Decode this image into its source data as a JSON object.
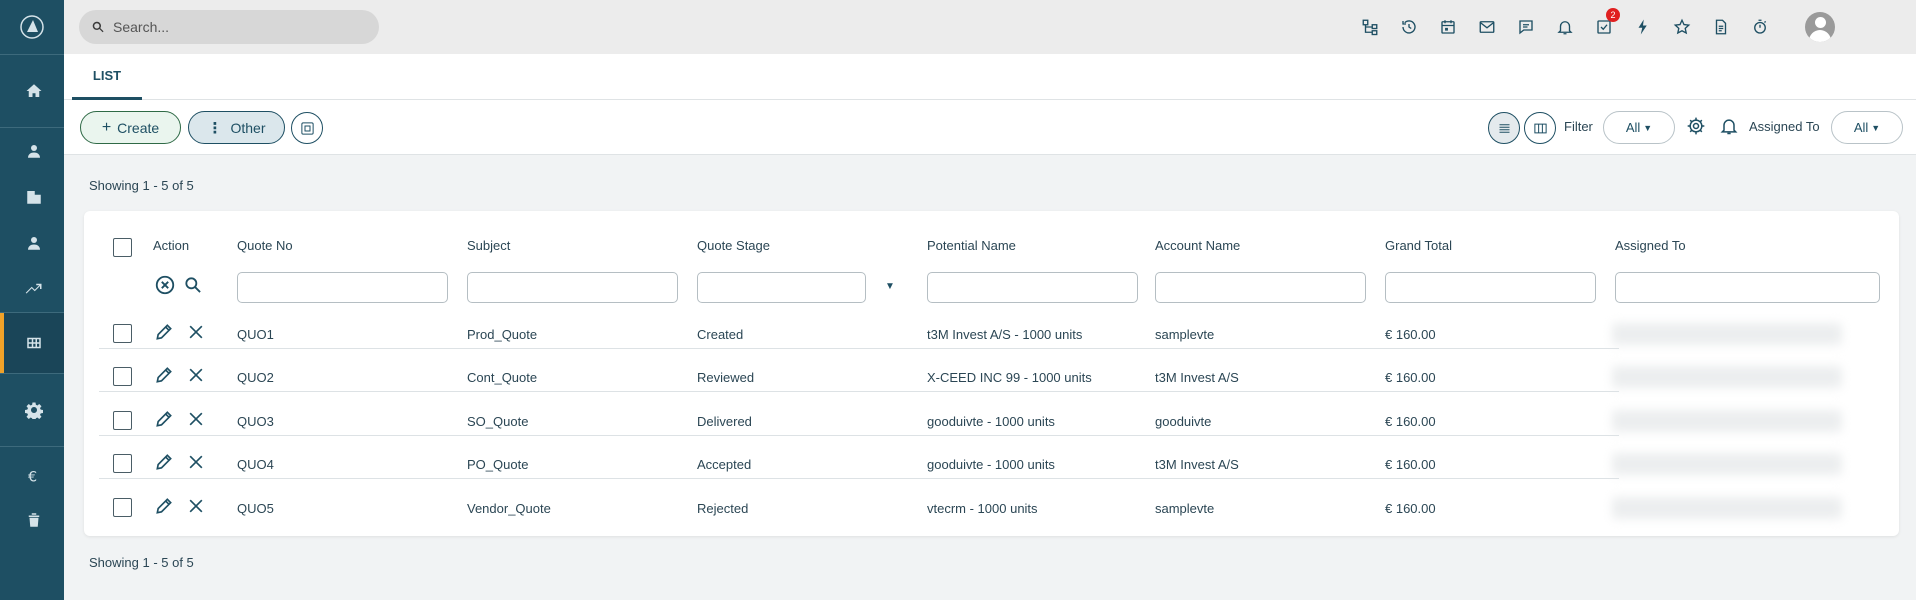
{
  "search": {
    "placeholder": "Search..."
  },
  "notifications": {
    "badge": "2"
  },
  "tabs": [
    {
      "label": "LIST"
    }
  ],
  "toolbar": {
    "create_label": "Create",
    "other_label": "Other",
    "filter_label": "Filter",
    "filter_value": "All",
    "assigned_label": "Assigned To",
    "assigned_value": "All"
  },
  "pagination": {
    "top": "Showing 1 - 5 of 5",
    "bottom": "Showing 1 - 5 of 5"
  },
  "table": {
    "columns": [
      "Action",
      "Quote No",
      "Subject",
      "Quote Stage",
      "Potential Name",
      "Account Name",
      "Grand Total",
      "Assigned To"
    ],
    "rows": [
      {
        "quote_no": "QUO1",
        "subject": "Prod_Quote",
        "stage": "Created",
        "potential": "t3M Invest A/S - 1000 units",
        "account": "samplevte",
        "total": "€ 160.00"
      },
      {
        "quote_no": "QUO2",
        "subject": "Cont_Quote",
        "stage": "Reviewed",
        "potential": "X-CEED INC 99 - 1000 units",
        "account": "t3M Invest A/S",
        "total": "€ 160.00"
      },
      {
        "quote_no": "QUO3",
        "subject": "SO_Quote",
        "stage": "Delivered",
        "potential": "gooduivte - 1000 units",
        "account": "gooduivte",
        "total": "€ 160.00"
      },
      {
        "quote_no": "QUO4",
        "subject": "PO_Quote",
        "stage": "Accepted",
        "potential": "gooduivte - 1000 units",
        "account": "t3M Invest A/S",
        "total": "€ 160.00"
      },
      {
        "quote_no": "QUO5",
        "subject": "Vendor_Quote",
        "stage": "Rejected",
        "potential": "vtecrm - 1000 units",
        "account": "samplevte",
        "total": "€ 160.00"
      }
    ]
  },
  "colors": {
    "sidebar": "#1e4f63",
    "accent": "#f0a229",
    "badge": "#e02020"
  }
}
